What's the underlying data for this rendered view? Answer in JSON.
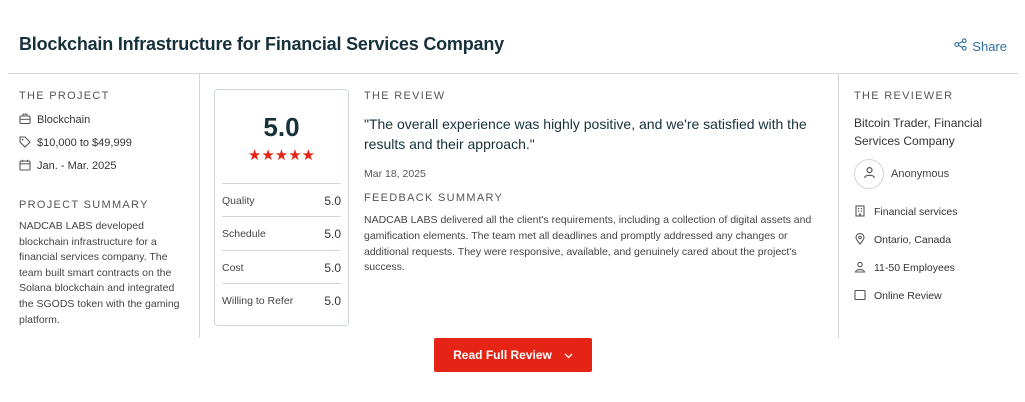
{
  "header": {
    "title": "Blockchain Infrastructure for Financial Services Company",
    "share_label": "Share"
  },
  "project": {
    "section_label": "THE PROJECT",
    "service": "Blockchain",
    "budget": "$10,000 to $49,999",
    "dates": "Jan. - Mar. 2025",
    "summary_label": "PROJECT SUMMARY",
    "summary": "NADCAB LABS developed blockchain infrastructure for a financial services company. The team built smart contracts on the Solana blockchain and integrated the SGODS token with the gaming platform."
  },
  "rating": {
    "overall": "5.0",
    "stars": "★★★★★",
    "rows": [
      {
        "label": "Quality",
        "value": "5.0"
      },
      {
        "label": "Schedule",
        "value": "5.0"
      },
      {
        "label": "Cost",
        "value": "5.0"
      },
      {
        "label": "Willing to Refer",
        "value": "5.0"
      }
    ]
  },
  "review": {
    "section_label": "THE REVIEW",
    "quote": "\"The overall experience was highly positive, and we're satisfied with the results and their approach.\"",
    "date": "Mar 18, 2025",
    "feedback_label": "FEEDBACK SUMMARY",
    "feedback": "NADCAB LABS delivered all the client's requirements, including a collection of digital assets and gamification elements. The team met all deadlines and promptly addressed any changes or additional requests. They were responsive, available, and genuinely cared about the project's success."
  },
  "reviewer": {
    "section_label": "THE REVIEWER",
    "title": "Bitcoin Trader, Financial Services Company",
    "name": "Anonymous",
    "industry": "Financial services",
    "location": "Ontario, Canada",
    "size": "11-50 Employees",
    "review_type": "Online Review"
  },
  "cta": {
    "label": "Read Full Review"
  },
  "colors": {
    "accent_red": "#e62415",
    "link_blue": "#2f6f9f",
    "title_dark": "#17313b"
  },
  "icons": [
    "share-icon",
    "briefcase-icon",
    "tag-icon",
    "calendar-icon",
    "user-icon",
    "building-icon",
    "location-pin-icon",
    "people-icon",
    "checkbox-icon",
    "chevron-down-icon"
  ]
}
